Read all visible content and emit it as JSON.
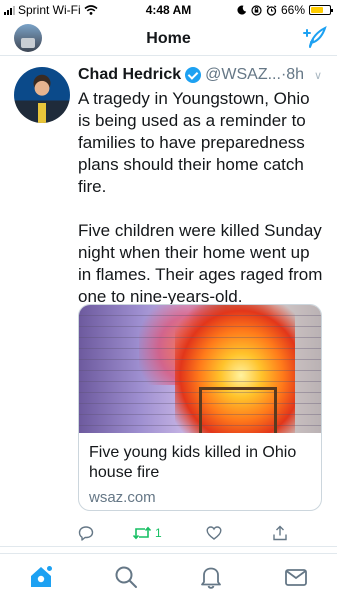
{
  "status_bar": {
    "carrier": "Sprint Wi-Fi",
    "time": "4:48 AM",
    "battery": "66%",
    "battery_level": 0.66
  },
  "header": {
    "title": "Home",
    "compose_icon": "compose-feather-icon"
  },
  "tweet": {
    "author_name": "Chad Hedrick",
    "handle": "@WSAZ...",
    "separator": "·",
    "time": "8h",
    "text": "A tragedy in Youngstown, Ohio is being used as a reminder to families to have preparedness plans should their home catch fire.\n\nFive children were killed Sunday night when their home went up in flames. Their ages raged from one to nine-years-old.",
    "card": {
      "title": "Five young kids killed in Ohio house fire",
      "domain": "wsaz.com"
    },
    "actions": {
      "retweet_count": "1"
    }
  },
  "tab_bar": {
    "items": [
      "home-icon",
      "search-icon",
      "notifications-bell-icon",
      "messages-envelope-icon"
    ],
    "active": "home-icon"
  },
  "colors": {
    "accent": "#1da1f2",
    "retweet": "#17bf63",
    "secondary_text": "#657786",
    "border": "#e1e8ed"
  }
}
